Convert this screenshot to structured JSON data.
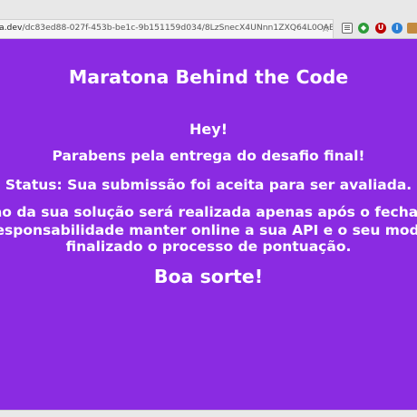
{
  "browser": {
    "url_host": "a.dev",
    "url_path": "/dc83ed88-027f-453b-be1c-9b151159d034/8LzSnecX4UNnn1ZXQ64L0OABb",
    "star_glyph": "☆",
    "extensions": [
      {
        "name": "reader-mode",
        "glyph": ""
      },
      {
        "name": "green-extension",
        "glyph": "◆"
      },
      {
        "name": "ublock",
        "glyph": "U"
      },
      {
        "name": "blue-extension",
        "glyph": "i"
      },
      {
        "name": "screenshot-extension",
        "glyph": ""
      }
    ]
  },
  "page": {
    "title": "Maratona Behind the Code",
    "greeting": "Hey!",
    "congrats": "Parabens pela entrega do desafio final!",
    "status": "Status: Sua submissão foi aceita para ser avaliada.",
    "paragraph_line1": "ção da sua solução será realizada apenas após o fecham",
    "paragraph_line2": "responsabilidade manter online a sua API e o seu mode",
    "paragraph_line3": "finalizado o processo de pontuação.",
    "closing": "Boa sorte!"
  },
  "colors": {
    "background": "#8a2be2",
    "text": "#ffffff"
  }
}
